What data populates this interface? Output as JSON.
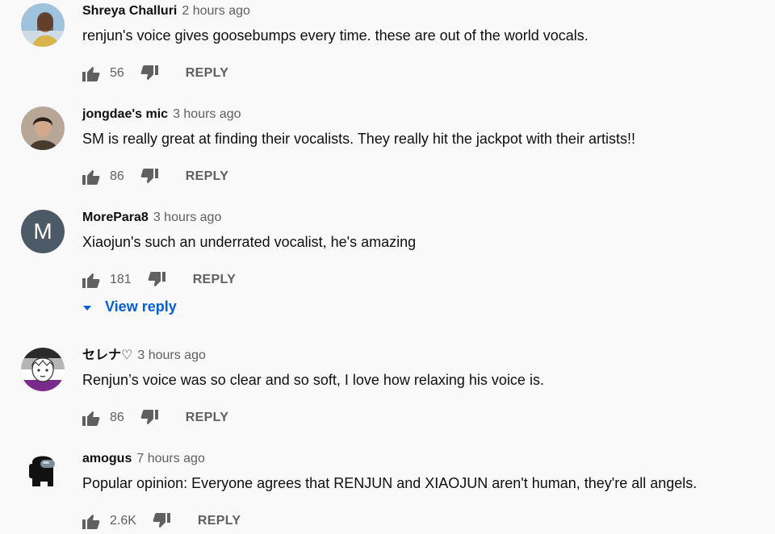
{
  "comments": [
    {
      "author": "Shreya Challuri",
      "time": "2 hours ago",
      "text": "renjun's voice gives goosebumps every time. these are out of the world vocals.",
      "likes": "56",
      "reply_label": "REPLY"
    },
    {
      "author": "jongdae's mic",
      "time": "3 hours ago",
      "text": "SM is really great at finding their vocalists. They really hit the jackpot with their artists!!",
      "likes": "86",
      "reply_label": "REPLY"
    },
    {
      "author": "MorePara8",
      "time": "3 hours ago",
      "text": "Xiaojun's such an underrated vocalist, he's amazing",
      "likes": "181",
      "reply_label": "REPLY",
      "avatar_letter": "M",
      "view_reply": "View reply"
    },
    {
      "author": "セレナ♡",
      "time": "3 hours ago",
      "text": "Renjun’s voice was so clear and so soft, I love how relaxing his voice is.",
      "likes": "86",
      "reply_label": "REPLY"
    },
    {
      "author": "amogus",
      "time": "7 hours ago",
      "text": "Popular opinion: Everyone agrees that RENJUN and XIAOJUN aren't human, they're all angels.",
      "likes": "2.6K",
      "reply_label": "REPLY"
    }
  ],
  "icons": {
    "like": "thumb-up-icon",
    "dislike": "thumb-down-icon",
    "expand": "caret-down-icon"
  },
  "colors": {
    "background": "#f9f9f9",
    "link_blue": "#065fd4",
    "secondary_text": "#606060",
    "avatar_letter_bg": "#4b5a66"
  }
}
